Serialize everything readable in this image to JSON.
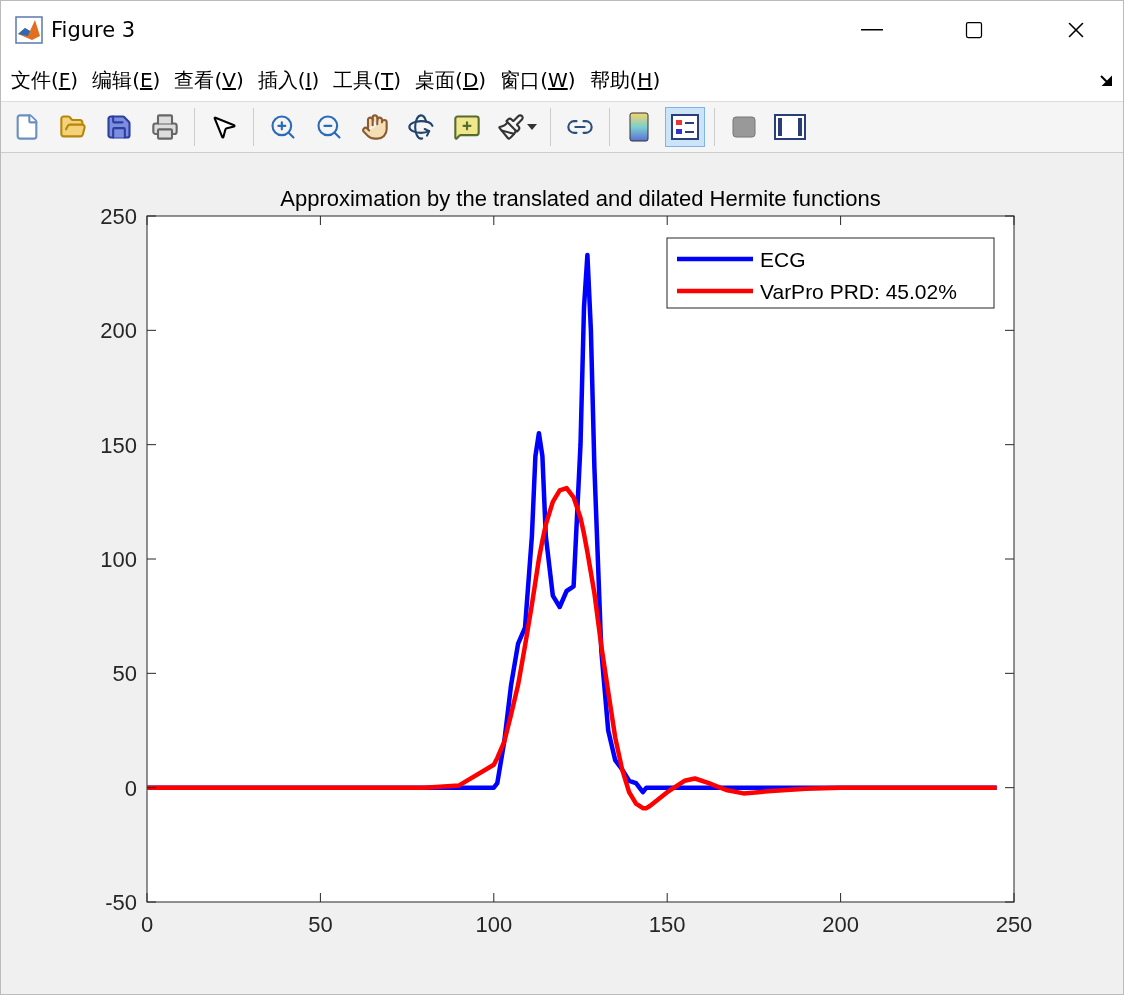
{
  "window": {
    "title": "Figure 3"
  },
  "menu": [
    {
      "text": "文件(",
      "key": "F",
      "end": ")"
    },
    {
      "text": "编辑(",
      "key": "E",
      "end": ")"
    },
    {
      "text": "查看(",
      "key": "V",
      "end": ")"
    },
    {
      "text": "插入(",
      "key": "I",
      "end": ")"
    },
    {
      "text": "工具(",
      "key": "T",
      "end": ")"
    },
    {
      "text": "桌面(",
      "key": "D",
      "end": ")"
    },
    {
      "text": "窗口(",
      "key": "W",
      "end": ")"
    },
    {
      "text": "帮助(",
      "key": "H",
      "end": ")"
    }
  ],
  "toolbar": [
    {
      "kind": "new",
      "selected": false
    },
    {
      "kind": "open",
      "selected": false
    },
    {
      "kind": "save",
      "selected": false
    },
    {
      "kind": "print",
      "selected": false
    },
    {
      "kind": "sep"
    },
    {
      "kind": "pointer",
      "selected": false
    },
    {
      "kind": "sep"
    },
    {
      "kind": "zoomin",
      "selected": false
    },
    {
      "kind": "zoomout",
      "selected": false
    },
    {
      "kind": "pan",
      "selected": false
    },
    {
      "kind": "rotate",
      "selected": false
    },
    {
      "kind": "datatip",
      "selected": false
    },
    {
      "kind": "brush",
      "selected": false
    },
    {
      "kind": "sep"
    },
    {
      "kind": "link",
      "selected": false
    },
    {
      "kind": "sep"
    },
    {
      "kind": "colorbar",
      "selected": false
    },
    {
      "kind": "legend",
      "selected": true
    },
    {
      "kind": "sep"
    },
    {
      "kind": "hide",
      "selected": false
    },
    {
      "kind": "show",
      "selected": false
    }
  ],
  "chart_data": {
    "type": "line",
    "title": "Approximation by the translated and dilated Hermite functions",
    "x": [
      0,
      80,
      90,
      100,
      101,
      103,
      105,
      107,
      109,
      111,
      112,
      113,
      114,
      115,
      117,
      119,
      121,
      123,
      125,
      126,
      127,
      128,
      129,
      131,
      133,
      135,
      137,
      139,
      141,
      143,
      144,
      145,
      150,
      155,
      158,
      162,
      167,
      172,
      180,
      190,
      200,
      245
    ],
    "series": [
      {
        "name": "ECG",
        "color": "#0000ff",
        "values": [
          0,
          0,
          0,
          0,
          2,
          20,
          45,
          63,
          70,
          110,
          145,
          155,
          145,
          110,
          84,
          79,
          86,
          88,
          150,
          210,
          233,
          200,
          140,
          60,
          25,
          12,
          8,
          3,
          2,
          -2,
          0,
          0,
          0,
          0,
          0,
          0,
          0,
          0,
          0,
          0,
          0,
          0
        ]
      },
      {
        "name": "VarPro PRD: 45.02%",
        "color": "#ff0000",
        "values": [
          0,
          0,
          1,
          10,
          13,
          20,
          32,
          45,
          62,
          80,
          90,
          100,
          108,
          115,
          125,
          130,
          131,
          127,
          118,
          111,
          103,
          94,
          85,
          62,
          42,
          22,
          8,
          -2,
          -7,
          -9,
          -9,
          -8,
          -2,
          3,
          4,
          2,
          -1,
          -2.5,
          -1.5,
          -0.5,
          0,
          0
        ]
      }
    ],
    "legend": "top right",
    "xlim": [
      0,
      250
    ],
    "ylim": [
      -50,
      250
    ],
    "xticks": [
      0,
      50,
      100,
      150,
      200,
      250
    ],
    "yticks": [
      -50,
      0,
      50,
      100,
      150,
      200,
      250
    ]
  }
}
